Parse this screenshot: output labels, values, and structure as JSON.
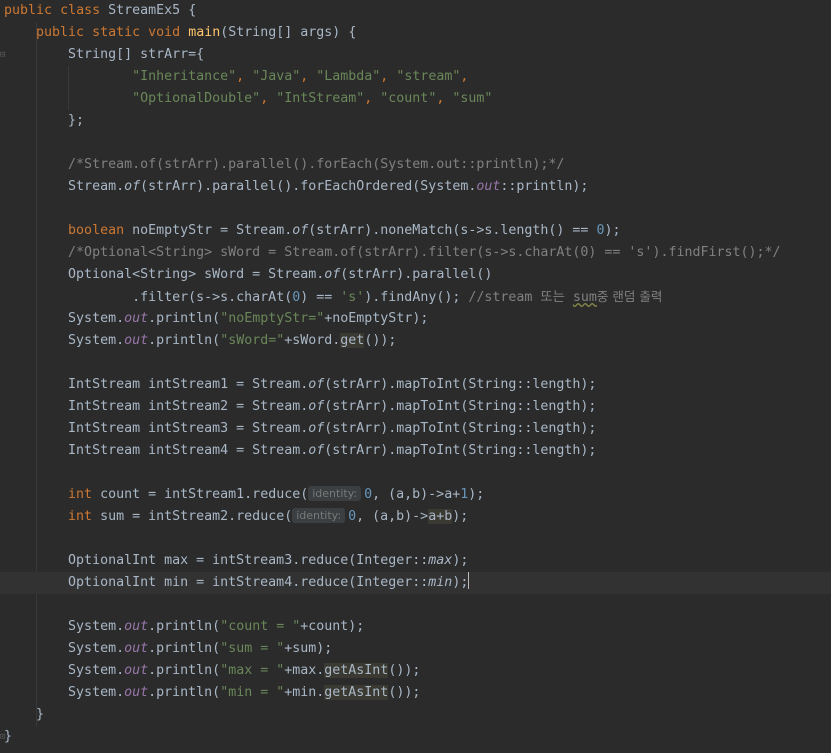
{
  "editor": {
    "lines": {
      "l0": [
        "public",
        "class",
        "StreamEx5",
        "{"
      ],
      "l1": [
        "public",
        "static",
        "void",
        "main",
        "(String[] args) {"
      ],
      "l2": [
        "String[] strArr={"
      ],
      "l3": [
        "\"Inheritance\"",
        "\"Java\"",
        "\"Lambda\"",
        "\"stream\""
      ],
      "l4": [
        "\"OptionalDouble\"",
        "\"IntStream\"",
        "\"count\"",
        "\"sum\""
      ],
      "l5": [
        "};"
      ],
      "l7": [
        "/*Stream.of(strArr).parallel().forEach(System.out::println);*/"
      ],
      "l8": [
        "Stream.",
        "of",
        "(strArr).parallel().forEachOrdered(System.",
        "out",
        "::println);"
      ],
      "l10": [
        "boolean",
        " noEmptyStr = Stream.",
        "of",
        "(strArr).noneMatch(s->s.length() == ",
        "0",
        ");"
      ],
      "l11": [
        "/*Optional<String> sWord = Stream.of(strArr).filter(s->s.charAt(0) == 's').findFirst();*/"
      ],
      "l12": [
        "Optional<String> sWord = Stream.",
        "of",
        "(strArr).parallel()"
      ],
      "l13": [
        ".filter(s->s.charAt(",
        "0",
        ") == ",
        "'s'",
        ").findAny(); ",
        "//stream 또는 ",
        "sum",
        "중 랜덤 출력"
      ],
      "l14": [
        "System.",
        "out",
        ".println(",
        "\"noEmptyStr=\"",
        "+noEmptyStr);"
      ],
      "l15": [
        "System.",
        "out",
        ".println(",
        "\"sWord=\"",
        "+sWord.",
        "get",
        "());"
      ],
      "l17": [
        "IntStream intStream1 = Stream.",
        "of",
        "(strArr).mapToInt(String::length);"
      ],
      "l18": [
        "IntStream intStream2 = Stream.",
        "of",
        "(strArr).mapToInt(String::length);"
      ],
      "l19": [
        "IntStream intStream3 = Stream.",
        "of",
        "(strArr).mapToInt(String::length);"
      ],
      "l20": [
        "IntStream intStream4 = Stream.",
        "of",
        "(strArr).mapToInt(String::length);"
      ],
      "l22": [
        "int",
        " count = intStream1.reduce(",
        "identity:",
        "0",
        ", (a,b)->a+",
        "1",
        ");"
      ],
      "l23": [
        "int",
        " sum = intStream2.reduce(",
        "identity:",
        "0",
        ", (a,b)->",
        "a+b",
        ");"
      ],
      "l25": [
        "OptionalInt max = intStream3.reduce(Integer::",
        "max",
        ");"
      ],
      "l26": [
        "OptionalInt min = intStream4.reduce(Integer::",
        "min",
        ");"
      ],
      "l28": [
        "System.",
        "out",
        ".println(",
        "\"count = \"",
        "+count);"
      ],
      "l29": [
        "System.",
        "out",
        ".println(",
        "\"sum = \"",
        "+sum);"
      ],
      "l30": [
        "System.",
        "out",
        ".println(",
        "\"max = \"",
        "+max.",
        "getAsInt",
        "());"
      ],
      "l31": [
        "System.",
        "out",
        ".println(",
        "\"min = \"",
        "+min.",
        "getAsInt",
        "());"
      ],
      "l32": [
        "}"
      ],
      "l33": [
        "}"
      ]
    },
    "colors": {
      "background": "#2b2b2b",
      "keyword": "#cc7832",
      "string": "#6a8759",
      "number": "#6897bb",
      "comment": "#808080",
      "method_decl": "#ffc66d",
      "static_field": "#9876aa",
      "text": "#a9b7c6"
    }
  }
}
